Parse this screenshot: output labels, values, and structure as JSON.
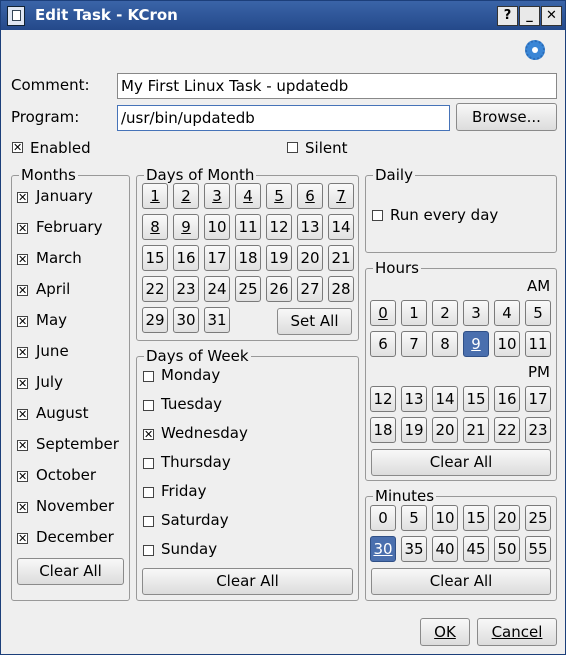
{
  "window": {
    "title": "Edit Task - KCron",
    "help": "?",
    "min": "_",
    "close": "✕"
  },
  "form": {
    "comment_label": "Comment:",
    "comment_value": "My First Linux Task - updatedb",
    "program_label": "Program:",
    "program_value": "/usr/bin/updatedb",
    "browse": "Browse...",
    "enabled": "Enabled",
    "silent": "Silent"
  },
  "months": {
    "title": "Months",
    "items": [
      "January",
      "February",
      "March",
      "April",
      "May",
      "June",
      "July",
      "August",
      "September",
      "October",
      "November",
      "December"
    ],
    "clear": "Clear All"
  },
  "dom": {
    "title": "Days of Month",
    "days": [
      "1",
      "2",
      "3",
      "4",
      "5",
      "6",
      "7",
      "8",
      "9",
      "10",
      "11",
      "12",
      "13",
      "14",
      "15",
      "16",
      "17",
      "18",
      "19",
      "20",
      "21",
      "22",
      "23",
      "24",
      "25",
      "26",
      "27",
      "28",
      "29",
      "30",
      "31"
    ],
    "setall": "Set All"
  },
  "dow": {
    "title": "Days of Week",
    "items": [
      "Monday",
      "Tuesday",
      "Wednesday",
      "Thursday",
      "Friday",
      "Saturday",
      "Sunday"
    ],
    "clear": "Clear All"
  },
  "daily": {
    "title": "Daily",
    "run": "Run every day"
  },
  "hours": {
    "title": "Hours",
    "am": "AM",
    "pm": "PM",
    "am_vals": [
      "0",
      "1",
      "2",
      "3",
      "4",
      "5",
      "6",
      "7",
      "8",
      "9",
      "10",
      "11"
    ],
    "pm_vals": [
      "12",
      "13",
      "14",
      "15",
      "16",
      "17",
      "18",
      "19",
      "20",
      "21",
      "22",
      "23"
    ],
    "clear": "Clear All"
  },
  "minutes": {
    "title": "Minutes",
    "vals": [
      "0",
      "5",
      "10",
      "15",
      "20",
      "25",
      "30",
      "35",
      "40",
      "45",
      "50",
      "55"
    ],
    "clear": "Clear All"
  },
  "footer": {
    "ok": "OK",
    "cancel": "Cancel"
  },
  "icons": {
    "app": "kcron-app-icon",
    "settings": "gear-icon"
  }
}
